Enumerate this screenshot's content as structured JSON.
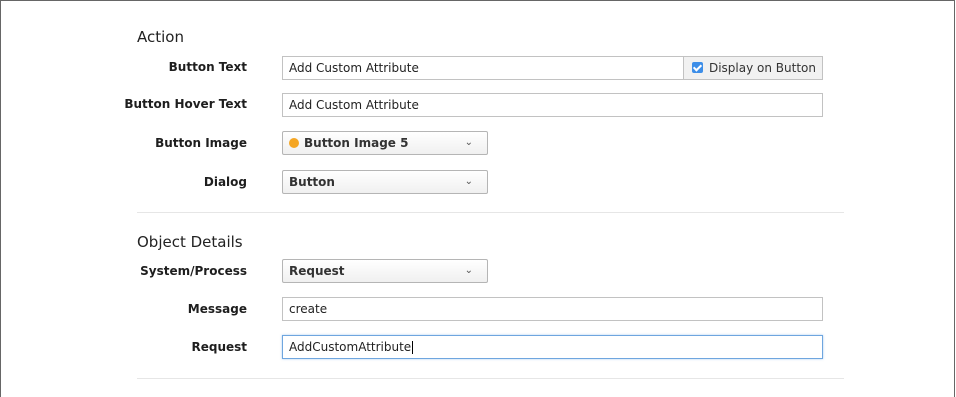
{
  "action": {
    "title": "Action",
    "button_text": {
      "label": "Button Text",
      "value": "Add Custom Attribute"
    },
    "display_on_button": {
      "label": "Display on Button",
      "checked": true
    },
    "button_hover_text": {
      "label": "Button Hover Text",
      "value": "Add Custom Attribute"
    },
    "button_image": {
      "label": "Button Image",
      "value": "Button Image 5",
      "dot_color": "#f5a623"
    },
    "dialog": {
      "label": "Dialog",
      "value": "Button"
    }
  },
  "object_details": {
    "title": "Object Details",
    "system_process": {
      "label": "System/Process",
      "value": "Request"
    },
    "message": {
      "label": "Message",
      "value": "create"
    },
    "request": {
      "label": "Request",
      "value": "AddCustomAttribute"
    }
  }
}
